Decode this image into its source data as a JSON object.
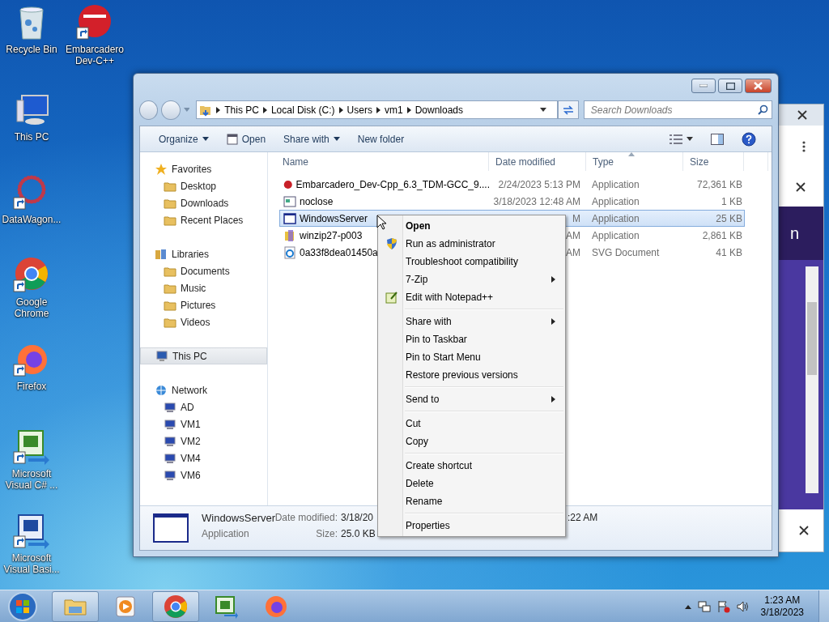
{
  "desktop_icons": [
    {
      "label": "Recycle Bin"
    },
    {
      "label": "Embarcadero Dev-C++"
    },
    {
      "label": "This PC"
    },
    {
      "label": "DataWagon..."
    },
    {
      "label": "Google Chrome"
    },
    {
      "label": "Firefox"
    },
    {
      "label": "Microsoft Visual C# ..."
    },
    {
      "label": "Microsoft Visual Basi..."
    }
  ],
  "background_window": {
    "fragment": "n"
  },
  "explorer": {
    "breadcrumbs": [
      "This PC",
      "Local Disk (C:)",
      "Users",
      "vm1",
      "Downloads"
    ],
    "search": {
      "placeholder": "Search Downloads"
    },
    "toolbar": [
      {
        "label": "Organize",
        "has_menu": true
      },
      {
        "label": "Open",
        "has_menu": false
      },
      {
        "label": "Share with",
        "has_menu": true
      },
      {
        "label": "New folder",
        "has_menu": false
      }
    ],
    "nav": [
      {
        "label": "Favorites",
        "selected": false,
        "children": [
          {
            "label": "Desktop",
            "selected": false
          },
          {
            "label": "Downloads",
            "selected": false
          },
          {
            "label": "Recent Places",
            "selected": false
          }
        ]
      },
      {
        "label": "Libraries",
        "selected": false,
        "children": [
          {
            "label": "Documents",
            "selected": false
          },
          {
            "label": "Music",
            "selected": false
          },
          {
            "label": "Pictures",
            "selected": false
          },
          {
            "label": "Videos",
            "selected": false
          }
        ]
      },
      {
        "label": "This PC",
        "selected": true
      },
      {
        "label": "Network",
        "selected": false,
        "children": [
          {
            "label": "AD",
            "selected": false
          },
          {
            "label": "VM1",
            "selected": false
          },
          {
            "label": "VM2",
            "selected": false
          },
          {
            "label": "VM4",
            "selected": false
          },
          {
            "label": "VM6",
            "selected": false
          }
        ]
      }
    ],
    "columns": [
      {
        "label": "Name",
        "sorted": false
      },
      {
        "label": "Date modified",
        "sorted": false
      },
      {
        "label": "Type",
        "sorted": true
      },
      {
        "label": "Size",
        "sorted": false
      }
    ],
    "files": [
      {
        "name": "Embarcadero_Dev-Cpp_6.3_TDM-GCC_9....",
        "date": "2/24/2023 5:13 PM",
        "type": "Application",
        "size": "72,361 KB",
        "selected": false
      },
      {
        "name": "noclose",
        "date": "3/18/2023 12:48 AM",
        "type": "Application",
        "size": "1 KB",
        "selected": false
      },
      {
        "name": "WindowsServer",
        "date": "M",
        "type": "Application",
        "size": "25 KB",
        "selected": true
      },
      {
        "name": "winzip27-p003",
        "date": "AM",
        "type": "Application",
        "size": "2,861 KB",
        "selected": false
      },
      {
        "name": "0a33f8dea01450a",
        "date": "AM",
        "type": "SVG Document",
        "size": "41 KB",
        "selected": false
      }
    ],
    "details": {
      "name": "WindowsServer",
      "type": "Application",
      "fields": [
        {
          "label": "Date modified:",
          "value": "3/18/20"
        },
        {
          "label": "Size:",
          "value": "25.0 KB"
        }
      ],
      "fragment": ":22 AM"
    }
  },
  "context_menu": {
    "groups": [
      [
        {
          "label": "Open",
          "default": true,
          "submenu": false
        },
        {
          "label": "Run as administrator",
          "default": false,
          "submenu": false
        },
        {
          "label": "Troubleshoot compatibility",
          "default": false,
          "submenu": false
        },
        {
          "label": "7-Zip",
          "default": false,
          "submenu": true
        },
        {
          "label": "Edit with Notepad++",
          "default": false,
          "submenu": false
        }
      ],
      [
        {
          "label": "Share with",
          "default": false,
          "submenu": true
        },
        {
          "label": "Pin to Taskbar",
          "default": false,
          "submenu": false
        },
        {
          "label": "Pin to Start Menu",
          "default": false,
          "submenu": false
        },
        {
          "label": "Restore previous versions",
          "default": false,
          "submenu": false
        }
      ],
      [
        {
          "label": "Send to",
          "default": false,
          "submenu": true
        }
      ],
      [
        {
          "label": "Cut",
          "default": false,
          "submenu": false
        },
        {
          "label": "Copy",
          "default": false,
          "submenu": false
        }
      ],
      [
        {
          "label": "Create shortcut",
          "default": false,
          "submenu": false
        },
        {
          "label": "Delete",
          "default": false,
          "submenu": false
        },
        {
          "label": "Rename",
          "default": false,
          "submenu": false
        }
      ],
      [
        {
          "label": "Properties",
          "default": false,
          "submenu": false
        }
      ]
    ]
  },
  "taskbar": {
    "apps": [
      {
        "active": true
      },
      {
        "active": false
      },
      {
        "active": true
      },
      {
        "active": false
      },
      {
        "active": false
      }
    ],
    "clock": {
      "time": "1:23 AM",
      "date": "3/18/2023"
    }
  }
}
